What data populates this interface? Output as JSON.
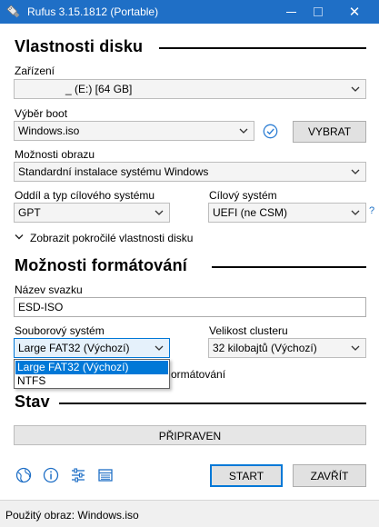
{
  "window": {
    "title": "Rufus 3.15.1812 (Portable)",
    "close_glyph": "✕"
  },
  "drive_props": {
    "heading": "Vlastnosti disku",
    "device_label": "Zařízení",
    "device_value": "_ (E:) [64 GB]",
    "boot_label": "Výběr boot",
    "boot_value": "Windows.iso",
    "select_button": "VYBRAT",
    "image_option_label": "Možnosti obrazu",
    "image_option_value": "Standardní instalace systému Windows",
    "partition_label": "Oddíl a typ cílového systému",
    "partition_value": "GPT",
    "target_label": "Cílový systém",
    "target_value": "UEFI (ne CSM)",
    "help_mark": "?",
    "advanced_toggle": "Zobrazit pokročilé vlastnosti disku"
  },
  "format_opts": {
    "heading": "Možnosti formátování",
    "volume_label": "Název svazku",
    "volume_value": "ESD-ISO",
    "fs_label": "Souborový systém",
    "fs_value": "Large FAT32 (Výchozí)",
    "cluster_label": "Velikost clusteru",
    "cluster_value": "32 kilobajtů (Výchozí)",
    "fs_options": [
      "Large FAT32 (Výchozí)",
      "NTFS"
    ],
    "hidden_text_fragment": "ormátování"
  },
  "status": {
    "heading": "Stav",
    "progress_text": "PŘIPRAVEN",
    "progress": 0
  },
  "actions": {
    "start": "START",
    "close": "ZAVŘÍT"
  },
  "statusbar": {
    "text": "Použitý obraz: Windows.iso"
  },
  "colors": {
    "titlebar": "#1f6fc6",
    "accent": "#0078d7"
  },
  "icons": [
    "app-usb-icon",
    "check-circle-icon",
    "chevron-down-icon",
    "globe-icon",
    "info-icon",
    "settings-sliders-icon",
    "log-table-icon"
  ]
}
